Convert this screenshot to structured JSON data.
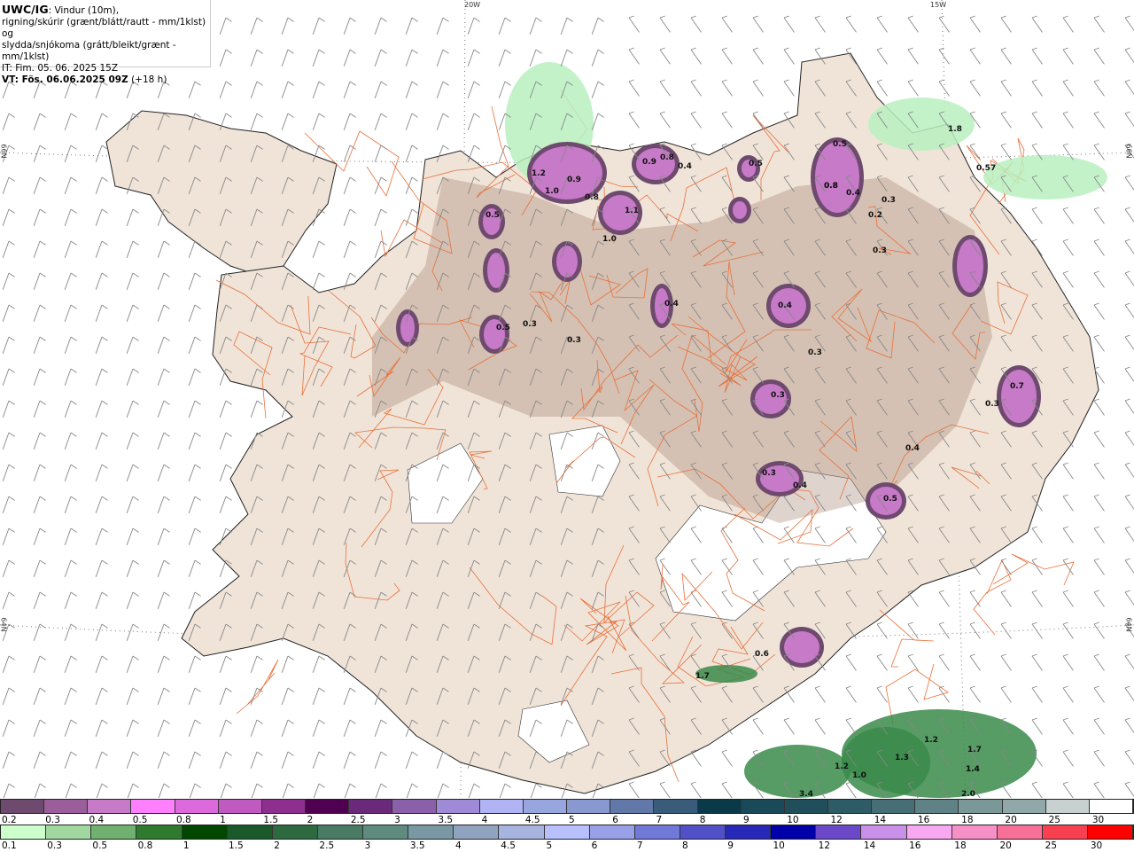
{
  "header": {
    "product": "UWC/IG",
    "line1": ": Vindur (10m),",
    "line2": "rigning/skúrir (grænt/blátt/rautt - mm/1klst) og",
    "line3": "slydda/snjókoma (grátt/bleikt/grænt - mm/1klst)",
    "issue_time": "IT: Fim. 05. 06. 2025 15Z",
    "valid_time": "VT: Fös. 06.06.2025 09Z",
    "lead": " (+18 h)"
  },
  "graticule": {
    "lon_labels": [
      "20W",
      "15W"
    ],
    "lat_labels": [
      "66N",
      "64N"
    ]
  },
  "colors": {
    "land": "#f0e4d8",
    "roads": "#e8703a",
    "sea": "#ffffff",
    "barbs": "#888888"
  },
  "snow_legend": {
    "labels": [
      "0.2",
      "0.3",
      "0.4",
      "0.5",
      "0.8",
      "1",
      "1.5",
      "2",
      "2.5",
      "3",
      "3.5",
      "4",
      "4.5",
      "5",
      "6",
      "7",
      "8",
      "9",
      "10",
      "12",
      "14",
      "16",
      "18",
      "20",
      "25",
      "30"
    ],
    "colors": [
      "#6e4a6e",
      "#9a5f9a",
      "#c77ac7",
      "#ff80ff",
      "#dd6add",
      "#c05ac0",
      "#8e2e8e",
      "#500050",
      "#6a2a7a",
      "#8a60aa",
      "#9e8ad6",
      "#b0b4f4",
      "#98a6e0",
      "#8898d0",
      "#6278a8",
      "#3a5c7a",
      "#0a3a4a",
      "#1a4a5a",
      "#204e5a",
      "#2e5c66",
      "#466e74",
      "#5e8286",
      "#7a9898",
      "#90a8a8",
      "#c8d0d0",
      "#ffffff"
    ]
  },
  "rain_legend": {
    "labels": [
      "0.1",
      "0.3",
      "0.5",
      "0.8",
      "1",
      "1.5",
      "2",
      "2.5",
      "3",
      "3.5",
      "4",
      "4.5",
      "5",
      "6",
      "7",
      "8",
      "9",
      "10",
      "12",
      "14",
      "16",
      "18",
      "20",
      "25",
      "30"
    ],
    "colors": [
      "#ccffcc",
      "#a0d8a0",
      "#70b070",
      "#2e7a2e",
      "#004800",
      "#1a5a2a",
      "#2e6a40",
      "#487a64",
      "#5e8a80",
      "#7a98a4",
      "#90a4c0",
      "#a8b4e0",
      "#b8c0ff",
      "#98a0e8",
      "#7078d8",
      "#5050c8",
      "#2828b8",
      "#0000a8",
      "#6a48c8",
      "#c890e8",
      "#f8a8f0",
      "#f890c8",
      "#f87098",
      "#f84050",
      "#ff0000"
    ]
  },
  "map_values": [
    "1.2",
    "1.0",
    "0.9",
    "0.8",
    "1.1",
    "1.0",
    "0.9",
    "0.8",
    "0.4",
    "0.5",
    "0.5",
    "0.8",
    "0.4",
    "0.2",
    "0.3",
    "0.3",
    "0.5",
    "0.3",
    "0.3",
    "0.4",
    "0.3",
    "0.3",
    "0.4",
    "0.7",
    "0.3",
    "0.4",
    "0.3",
    "0.4",
    "0.5",
    "0.5",
    "0.8",
    "0.6",
    "1.7",
    "1.2",
    "1.3",
    "1.2",
    "1.4",
    "1.0",
    "1.7",
    "1.4",
    "2.0",
    "3.4",
    "1.8",
    "0.5",
    "7"
  ]
}
